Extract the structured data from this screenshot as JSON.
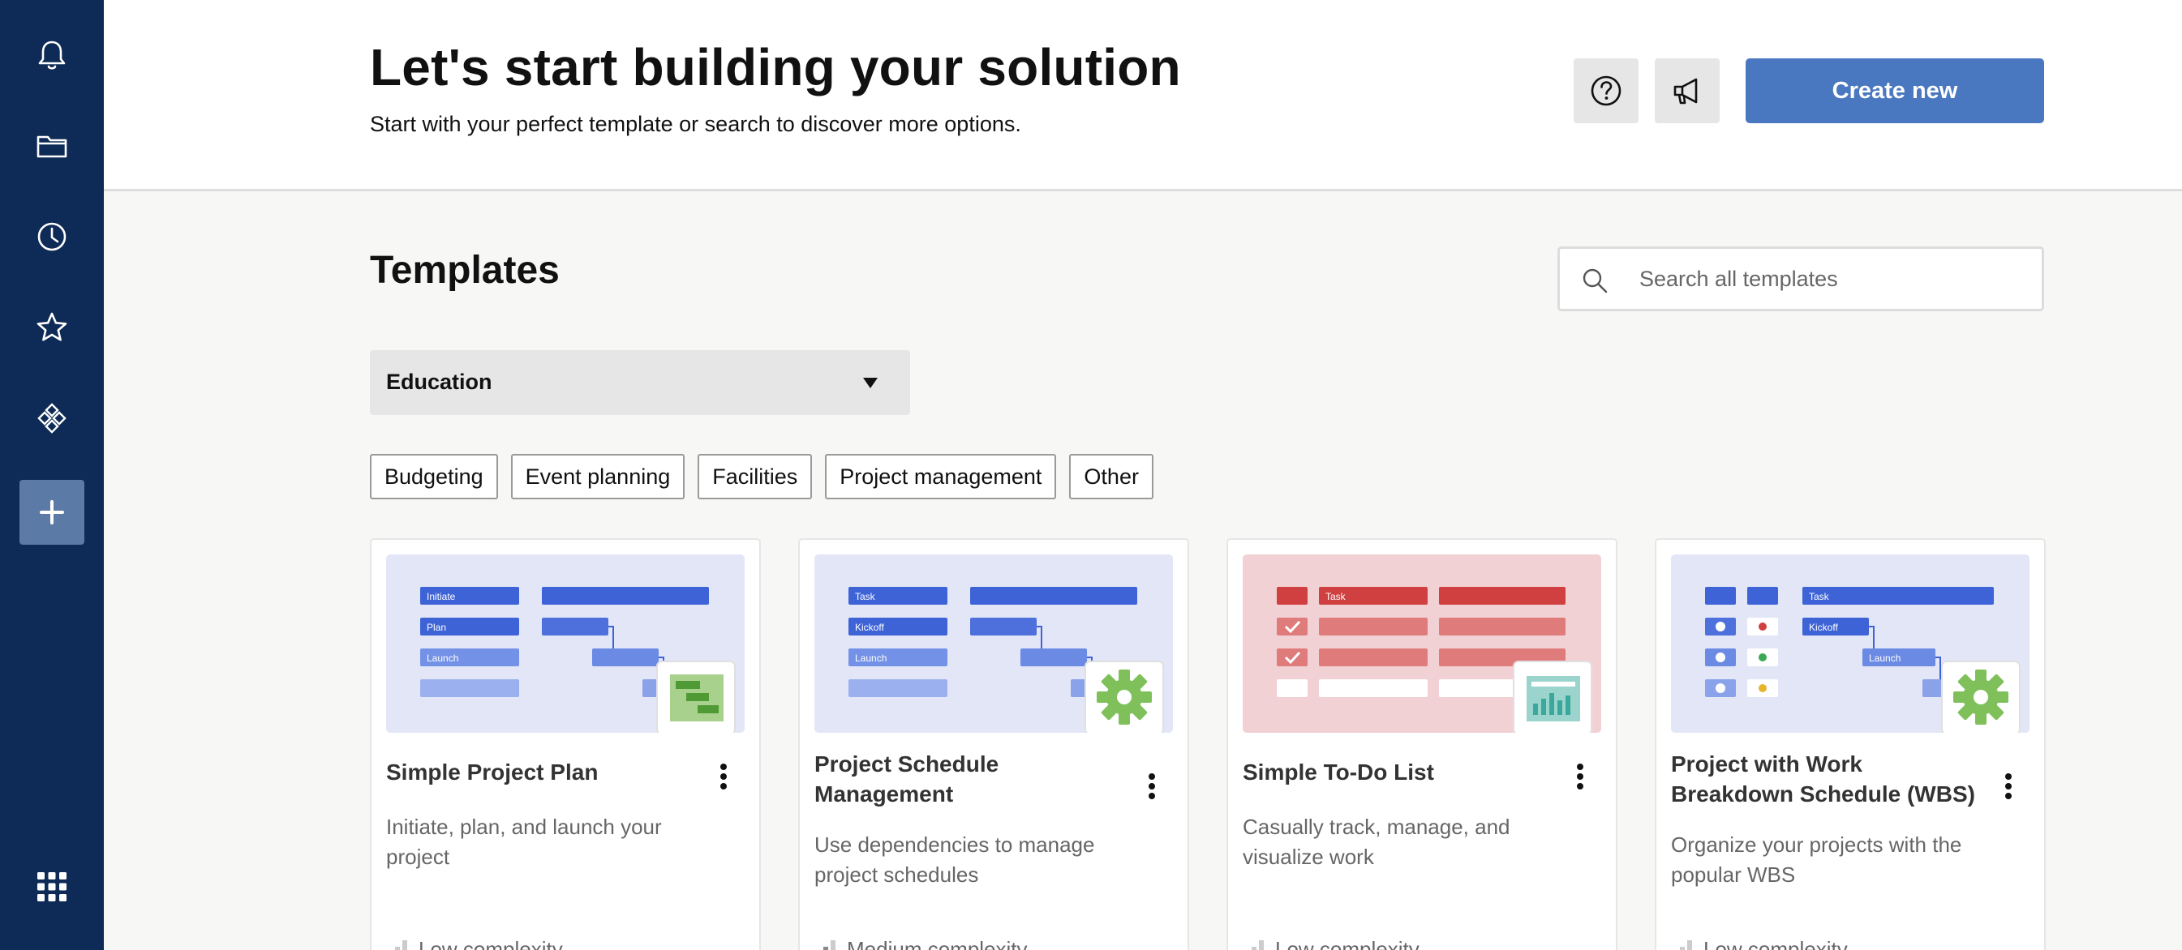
{
  "sidebar": {
    "items": [
      {
        "name": "notifications",
        "icon": "bell-icon"
      },
      {
        "name": "browse",
        "icon": "folder-icon"
      },
      {
        "name": "recents",
        "icon": "clock-icon"
      },
      {
        "name": "favorites",
        "icon": "star-icon"
      },
      {
        "name": "workapps",
        "icon": "diamond-grid-icon"
      },
      {
        "name": "create",
        "icon": "plus-icon",
        "active": true
      }
    ],
    "launcher_icon": "app-grid-icon",
    "colors": {
      "background": "#0e2a56",
      "active": "#5b7aa6"
    }
  },
  "header": {
    "title": "Let's start building your solution",
    "subtitle": "Start with your perfect template or search to discover more options.",
    "help_icon": "help-circle-icon",
    "announcements_icon": "megaphone-icon",
    "create_label": "Create new",
    "accent": "#4a78c0"
  },
  "templates": {
    "section_title": "Templates",
    "search": {
      "placeholder": "Search all templates",
      "value": ""
    },
    "category": {
      "selected": "Education"
    },
    "filters": [
      "Budgeting",
      "Event planning",
      "Facilities",
      "Project management",
      "Other"
    ],
    "cards": [
      {
        "title": "Simple Project Plan",
        "description": "Initiate, plan, and launch your project",
        "complexity": "Low complexity",
        "thumb_labels": [
          "Initiate",
          "Plan",
          "Launch"
        ],
        "badge_icon": "gantt-icon"
      },
      {
        "title": "Project Schedule Management",
        "description": "Use dependencies to manage project schedules",
        "complexity": "Medium complexity",
        "thumb_labels": [
          "Task",
          "Kickoff",
          "Launch"
        ],
        "badge_icon": "gear-icon"
      },
      {
        "title": "Simple To-Do List",
        "description": "Casually track, manage, and visualize work",
        "complexity": "Low complexity",
        "thumb_labels": [
          "Task"
        ],
        "badge_icon": "dashboard-icon"
      },
      {
        "title": "Project with Work Breakdown Schedule (WBS)",
        "description": "Organize your projects with the popular WBS",
        "complexity": "Low complexity",
        "thumb_labels": [
          "Task",
          "Kickoff",
          "Launch"
        ],
        "badge_icon": "gear-icon"
      }
    ]
  }
}
